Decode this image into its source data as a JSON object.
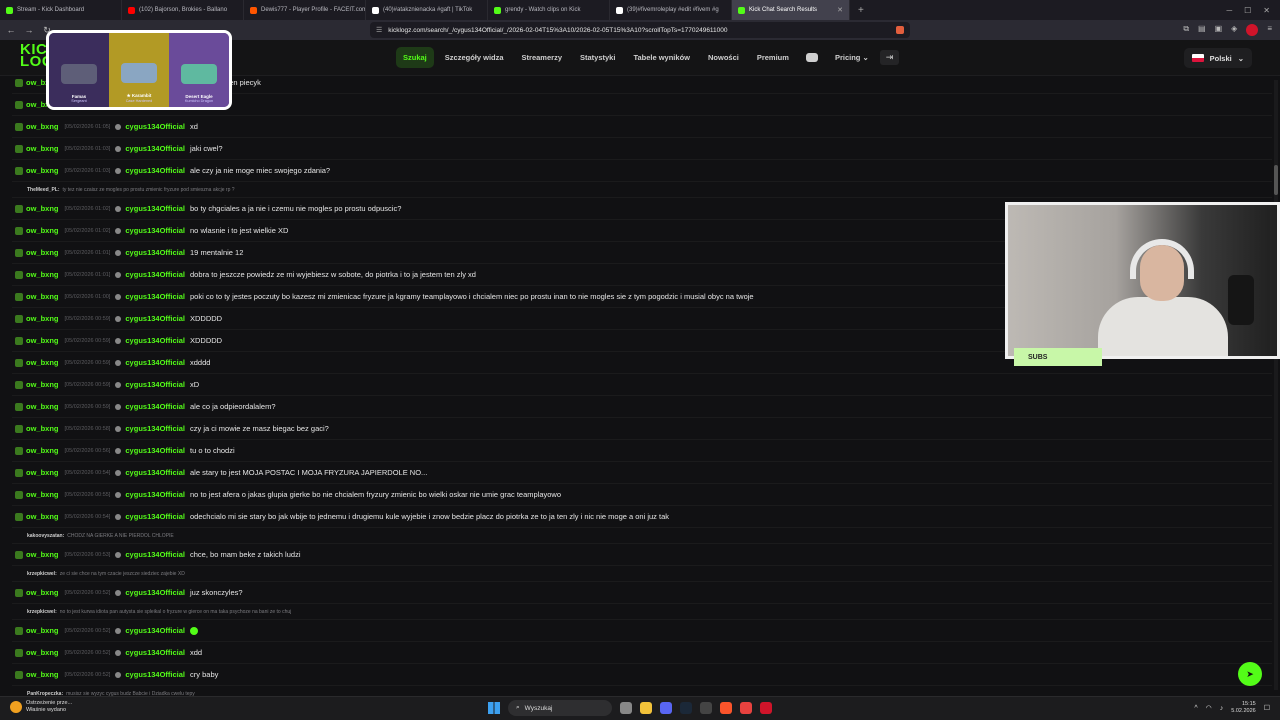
{
  "browser": {
    "tabs": [
      {
        "label": "Stream - Kick Dashboard",
        "color": "#53fc18"
      },
      {
        "label": "(102) Bajorson, Brokies - Ballano",
        "color": "#ff0000"
      },
      {
        "label": "Dewis777 - Player Profile - FACEIT.com",
        "color": "#ff5500"
      },
      {
        "label": "(40)#atakznienacka #gaft | TikTok",
        "color": "#ffffff"
      },
      {
        "label": "grendy - Watch clips on Kick",
        "color": "#53fc18"
      },
      {
        "label": "(39)#fivemroleplay #edit #fivem #g",
        "color": "#ffffff"
      },
      {
        "label": "Kick Chat Search Results",
        "color": "#53fc18"
      }
    ],
    "new_tab": "+",
    "url": "kicklogz.com/search/_/cygus134Official/_/2026-02-04T15%3A10/2026-02-05T15%3A10?scrollTopTs=1770249611000"
  },
  "site": {
    "logo_line1": "KIC",
    "logo_line2": "LOG",
    "nav": {
      "search": "Szukaj",
      "viewer": "Szczegóły widza",
      "streamers": "Streamerzy",
      "stats": "Statystyki",
      "leaderboards": "Tabele wyników",
      "news": "Nowości",
      "premium": "Premium",
      "pricing": "Pricing"
    },
    "language": "Polski"
  },
  "chat": [
    {
      "user": "ow_bxng",
      "time": "[05/02/2026 01:07]",
      "target": "cygus134Official",
      "text": "ale tam na ten piecyk"
    },
    {
      "user": "ow_bxng",
      "time": "[05/02/2026 01:06]",
      "target": "cygus134Official",
      "text": "gadasz?"
    },
    {
      "user": "ow_bxng",
      "time": "[05/02/2026 01:05]",
      "target": "cygus134Official",
      "text": "xd"
    },
    {
      "user": "ow_bxng",
      "time": "[05/02/2026 01:03]",
      "target": "cygus134Official",
      "text": "jaki cwel?"
    },
    {
      "user": "ow_bxng",
      "time": "[05/02/2026 01:03]",
      "target": "cygus134Official",
      "text": "ale czy ja nie moge miec swojego zdania?",
      "reply": {
        "user": "TheMeed_PL:",
        "text": "ty tez nie czaisz ze mogles po prostu zmienic fryzure pod smieszna akcje rp ?"
      }
    },
    {
      "user": "ow_bxng",
      "time": "[05/02/2026 01:02]",
      "target": "cygus134Official",
      "text": "bo ty chgciales a ja nie i czemu nie mogles po prostu odpuscic?"
    },
    {
      "user": "ow_bxng",
      "time": "[05/02/2026 01:02]",
      "target": "cygus134Official",
      "text": "no wlasnie i to jest wielkie XD"
    },
    {
      "user": "ow_bxng",
      "time": "[05/02/2026 01:01]",
      "target": "cygus134Official",
      "text": "19 mentalnie 12"
    },
    {
      "user": "ow_bxng",
      "time": "[05/02/2026 01:01]",
      "target": "cygus134Official",
      "text": "dobra to jeszcze powiedz ze mi wyjebiesz w sobote, do piotrka i to ja jestem ten zly xd"
    },
    {
      "user": "ow_bxng",
      "time": "[05/02/2026 01:00]",
      "target": "cygus134Official",
      "text": "poki co to ty jestes poczuty bo kazesz mi zmienicac fryzure ja kgramy teamplayowo i chcialem niec po prostu inan to nie mogles sie z tym pogodzic i musial obyc na twoje"
    },
    {
      "user": "ow_bxng",
      "time": "[05/02/2026 00:59]",
      "target": "cygus134Official",
      "text": "XDDDDD"
    },
    {
      "user": "ow_bxng",
      "time": "[05/02/2026 00:59]",
      "target": "cygus134Official",
      "text": "XDDDDD"
    },
    {
      "user": "ow_bxng",
      "time": "[05/02/2026 00:59]",
      "target": "cygus134Official",
      "text": "xdddd"
    },
    {
      "user": "ow_bxng",
      "time": "[05/02/2026 00:59]",
      "target": "cygus134Official",
      "text": "xD"
    },
    {
      "user": "ow_bxng",
      "time": "[05/02/2026 00:59]",
      "target": "cygus134Official",
      "text": "ale co ja odpieordalalem?"
    },
    {
      "user": "ow_bxng",
      "time": "[05/02/2026 00:58]",
      "target": "cygus134Official",
      "text": "czy ja ci mowie ze masz biegac bez gaci?"
    },
    {
      "user": "ow_bxng",
      "time": "[05/02/2026 00:56]",
      "target": "cygus134Official",
      "text": "tu o to chodzi"
    },
    {
      "user": "ow_bxng",
      "time": "[05/02/2026 00:54]",
      "target": "cygus134Official",
      "text": "ale stary to jest MOJA POSTAC I MOJA FRYZURA JAPIERDOLE NO..."
    },
    {
      "user": "ow_bxng",
      "time": "[05/02/2026 00:55]",
      "target": "cygus134Official",
      "text": "no to jest afera o jakas glupia gierke bo nie chcialem fryzury zmienic bo wielki oskar nie umie grac teamplayowo"
    },
    {
      "user": "ow_bxng",
      "time": "[05/02/2026 00:54]",
      "target": "cygus134Official",
      "text": "odechcialo mi sie stary bo jak wbije to jednemu i drugiemu kule wyjebie i znow bedzie placz do piotrka ze to ja ten zly i nic nie moge a oni juz tak",
      "reply": {
        "user": "kakoovyszatan:",
        "text": "CHODZ NA GIERKE A NIE PIERDOL CHLOPIE"
      }
    },
    {
      "user": "ow_bxng",
      "time": "[05/02/2026 00:53]",
      "target": "cygus134Official",
      "text": "chce, bo mam beke z takich ludzi",
      "reply": {
        "user": "krzepkicwel:",
        "text": "ze ci sie chce na tym czacie jeszcze siedziec zajebie XD"
      }
    },
    {
      "user": "ow_bxng",
      "time": "[05/02/2026 00:52]",
      "target": "cygus134Official",
      "text": "juz skonczyles?",
      "reply": {
        "user": "krzepkicwel:",
        "text": "no to jest kurwa idiota pan autysta sie spleikal o fryzure w gierce on ma taka psychoze na bani ze to chuj"
      }
    },
    {
      "user": "ow_bxng",
      "time": "[05/02/2026 00:52]",
      "target": "cygus134Official",
      "text": "",
      "emote": true
    },
    {
      "user": "ow_bxng",
      "time": "[05/02/2026 00:52]",
      "target": "cygus134Official",
      "text": "xdd"
    },
    {
      "user": "ow_bxng",
      "time": "[05/02/2026 00:52]",
      "target": "cygus134Official",
      "text": "cry baby",
      "reply": {
        "user": "PanKropeczka:",
        "text": "musisz sie wyzyc cygus budz Babcie i Dziadka cwelu tepy"
      }
    }
  ],
  "overlay": {
    "skins": [
      {
        "name": "Famas",
        "sub": "Sergeant"
      },
      {
        "name": "★ Karambit",
        "sub": "Case Hardened"
      },
      {
        "name": "Desert Eagle",
        "sub": "Kumicho Dragon"
      }
    ],
    "subs_label": "SUBS"
  },
  "taskbar": {
    "weather_line1": "Ostrzeżenie prze...",
    "weather_line2": "Właśnie wydano",
    "search_placeholder": "Wyszukaj",
    "time": "15:15",
    "date": "5.02.2026"
  },
  "colors": {
    "accent": "#53fc18",
    "background": "#111113"
  }
}
